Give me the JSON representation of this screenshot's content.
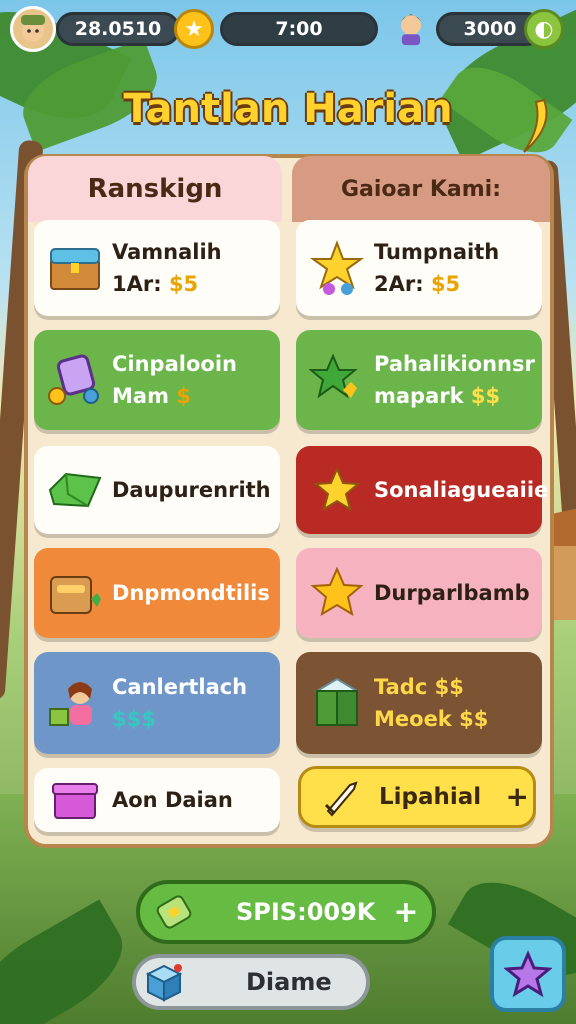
{
  "topbar": {
    "left_value": "28.0510",
    "timer": "7:00",
    "right_value": "3000"
  },
  "title": "Tantlan Harian",
  "tabs": {
    "left": "Ranskign",
    "right": "Gaioar Kami:"
  },
  "left_cards": [
    {
      "line1": "Vamnalih",
      "line2": "1Ar:",
      "accent": "$5",
      "icon": "treasure-chest-icon"
    },
    {
      "line1": "Cinpalooin",
      "line2": "Mam",
      "accent": "$",
      "icon": "mirror-icon"
    },
    {
      "line1": "Daupurenrith",
      "line2": "",
      "accent": "",
      "icon": "green-gem-icon"
    },
    {
      "line1": "Dnpmondtilis",
      "line2": "",
      "accent": "",
      "icon": "chest-icon"
    },
    {
      "line1": "Canlertlach",
      "line2": "",
      "accent": "$$$",
      "icon": "character-icon"
    },
    {
      "line1": "Aon Daian",
      "line2": "",
      "accent": "",
      "icon": "purple-box-icon"
    }
  ],
  "right_cards": [
    {
      "line1": "Tumpnaith",
      "line2": "2Ar:",
      "accent": "$5",
      "icon": "star-trophy-icon"
    },
    {
      "line1": "Pahalikionnsr",
      "line2": "mapark",
      "accent": "$$",
      "icon": "green-star-icon"
    },
    {
      "line1": "Sonaliagueaiie",
      "line2": "",
      "accent": "",
      "icon": "gold-star-icon"
    },
    {
      "line1": "Durparlbamb",
      "line2": "",
      "accent": "",
      "icon": "gold-star-icon"
    },
    {
      "line1": "Tadc",
      "line2": "Meoek",
      "accent": "$$",
      "icon": "crate-icon"
    },
    {
      "line1": "Lipahial",
      "line2": "",
      "accent": "+",
      "icon": "sword-icon"
    }
  ],
  "big_button": {
    "label": "SPIS:009K",
    "plus": "+"
  },
  "bottom_button": {
    "label": "Diame"
  },
  "colors": {
    "title": "#ffd22e",
    "primary_green": "#66bb42",
    "panel": "#f7e9cf",
    "accent_yellow": "#ffe04a"
  }
}
